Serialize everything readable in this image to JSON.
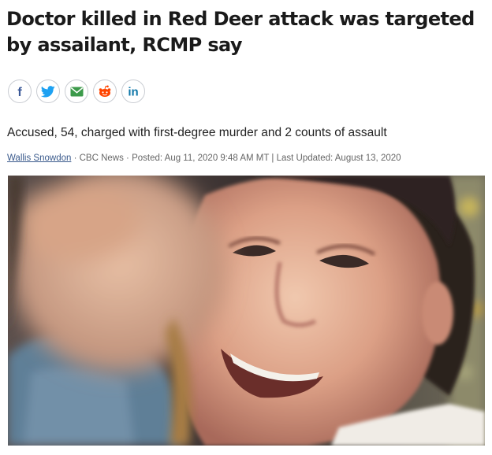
{
  "article": {
    "headline": "Doctor killed in Red Deer attack was targeted by assailant, RCMP say",
    "deck": "Accused, 54, charged with first-degree murder and 2 counts of assault",
    "byline": {
      "author": "Wallis Snowdon",
      "separator": " · ",
      "source": "CBC News",
      "posted": "Posted: Aug 11, 2020 9:48 AM MT",
      "divider": " | ",
      "updated": "Last Updated: August 13, 2020"
    }
  },
  "share": {
    "buttons": [
      {
        "icon": "facebook-icon",
        "glyph": "f",
        "color": "#3b5998"
      },
      {
        "icon": "twitter-icon",
        "color": "#1da1f2"
      },
      {
        "icon": "email-icon",
        "color": "#3c9a4a"
      },
      {
        "icon": "reddit-icon",
        "color": "#ff4500"
      },
      {
        "icon": "linkedin-icon",
        "glyph": "in",
        "color": "#0e76a8"
      }
    ]
  }
}
